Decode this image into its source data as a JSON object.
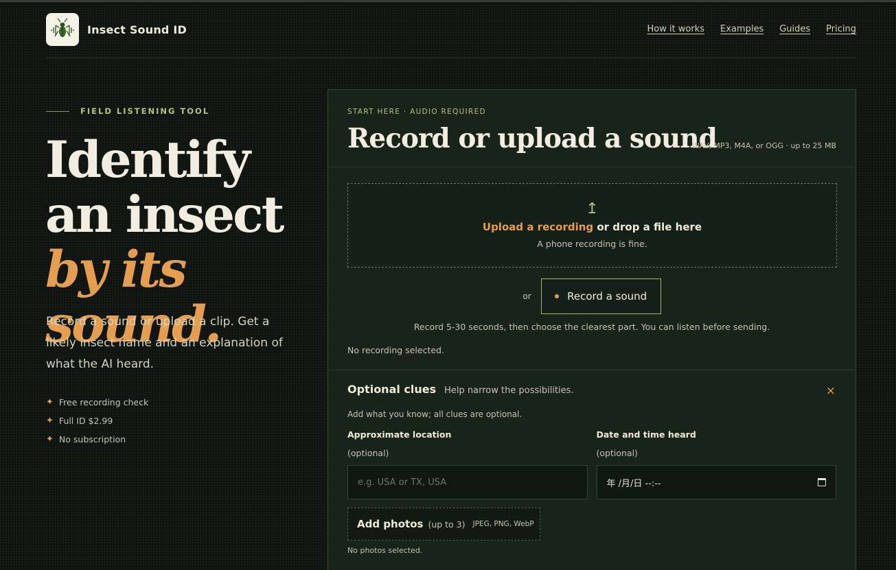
{
  "brand": {
    "name": "Insect Sound ID",
    "logo_icon": "cricket-sound-icon"
  },
  "nav": [
    "How it works",
    "Examples",
    "Guides",
    "Pricing"
  ],
  "hero": {
    "eyebrow": "FIELD LISTENING TOOL",
    "headline_part1": "Identify an insect ",
    "headline_accent": "by its sound.",
    "lead": "Record a sound or upload a clip. Get a likely insect name and an explanation of what the AI heard.",
    "perks": [
      "Free recording check",
      "Full ID $2.99",
      "No subscription"
    ]
  },
  "panel": {
    "kicker": "START HERE · AUDIO REQUIRED",
    "title": "Record or upload a sound",
    "formats": "WAV, MP3, M4A, or OGG · up to 25 MB",
    "upload_link": "Upload a recording",
    "upload_rest": " or drop a file here",
    "upload_sub": "A phone recording is fine.",
    "or_label": "or",
    "record_button": "Record a sound",
    "record_hint": "Record 5-30 seconds, then choose the clearest part. You can listen before sending.",
    "status": "No recording selected."
  },
  "clues": {
    "title": "Optional clues",
    "subtitle": "Help narrow the possibilities.",
    "close": "×",
    "note": "Add what you know; all clues are optional.",
    "location_label": "Approximate location",
    "location_optional": "(optional)",
    "location_placeholder": "e.g. USA or TX, USA",
    "datetime_label": "Date and time heard",
    "datetime_optional": "(optional)",
    "datetime_value": "年 /月/日  --:--",
    "photos_title": "Add photos",
    "photos_limit": "(up to 3)",
    "photos_types": "JPEG, PNG, WebP",
    "photos_status": "No photos selected."
  },
  "colors": {
    "accent": "#e59d4f",
    "olive": "#b9c07e",
    "bg": "#0f1410",
    "panel": "#18231a"
  }
}
